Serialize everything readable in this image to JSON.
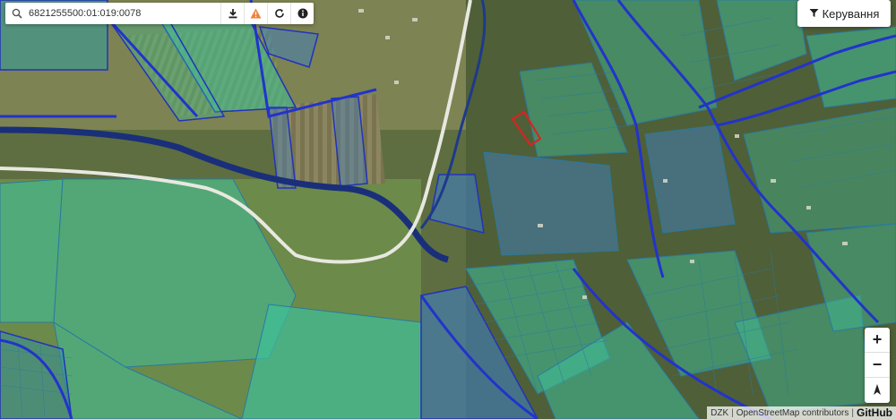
{
  "search": {
    "value": "6821255500:01:019:0078"
  },
  "manage_button": {
    "label": "Керування"
  },
  "zoom": {
    "in_label": "+",
    "out_label": "−"
  },
  "attribution": {
    "dzk": "DZK",
    "osm": "OpenStreetMap contributors",
    "github": "GitHub"
  },
  "map": {
    "colors": {
      "parcel_fill_teal": "#3fbf9a",
      "parcel_fill_blue": "#3f7fbf",
      "parcel_border": "#2233bb",
      "selected_parcel": "#e02020",
      "road": "#e8e8e0",
      "river": "#1a2f7a",
      "field_olive": "#7c8a4c",
      "field_dark": "#3f5230"
    }
  }
}
